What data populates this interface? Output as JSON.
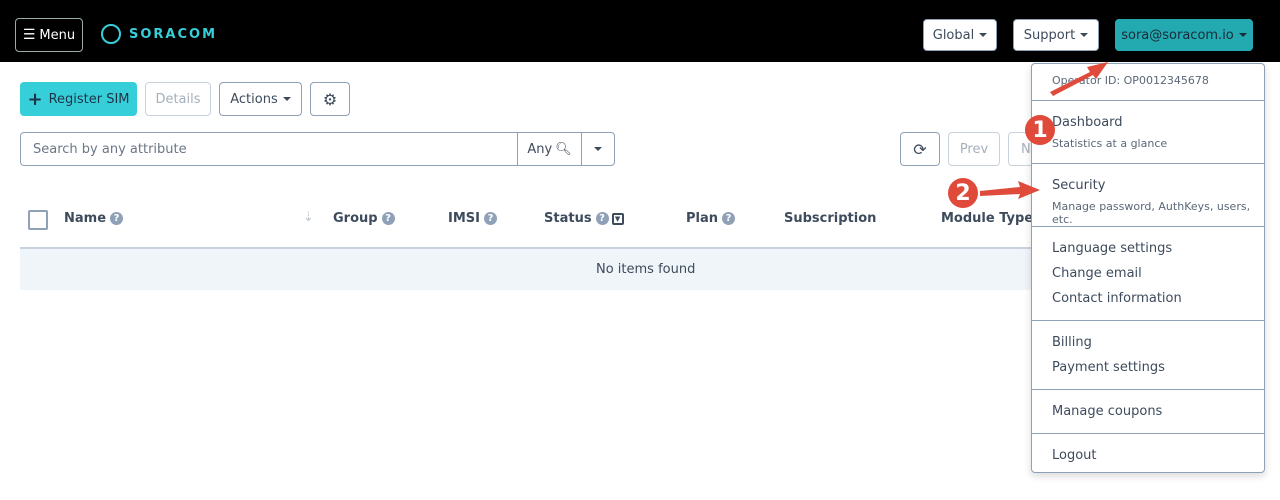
{
  "header": {
    "menu_label": "Menu",
    "logo_text": "SORACOM",
    "global_label": "Global",
    "support_label": "Support",
    "account_label": "sora@soracom.io",
    "accent": "#22aab0"
  },
  "toolbar": {
    "register_label": "Register SIM",
    "details_label": "Details",
    "actions_label": "Actions",
    "settings_icon": "gear-icon"
  },
  "search": {
    "placeholder": "Search by any attribute",
    "scope_label": "Any",
    "prev_label": "Prev",
    "next_label": "N"
  },
  "table": {
    "columns": [
      "Name",
      "Group",
      "IMSI",
      "Status",
      "Plan",
      "Subscription",
      "Module Type"
    ],
    "empty_text": "No items found"
  },
  "account_menu": {
    "operator_id": "Operator ID: OP0012345678",
    "dashboard": {
      "label": "Dashboard",
      "desc": "Statistics at a glance"
    },
    "security": {
      "label": "Security",
      "desc": "Manage password, AuthKeys, users, etc."
    },
    "items": [
      "Language settings",
      "Change email",
      "Contact information",
      "Billing",
      "Payment settings",
      "Manage coupons",
      "Logout"
    ]
  },
  "annotations": [
    "1",
    "2"
  ]
}
